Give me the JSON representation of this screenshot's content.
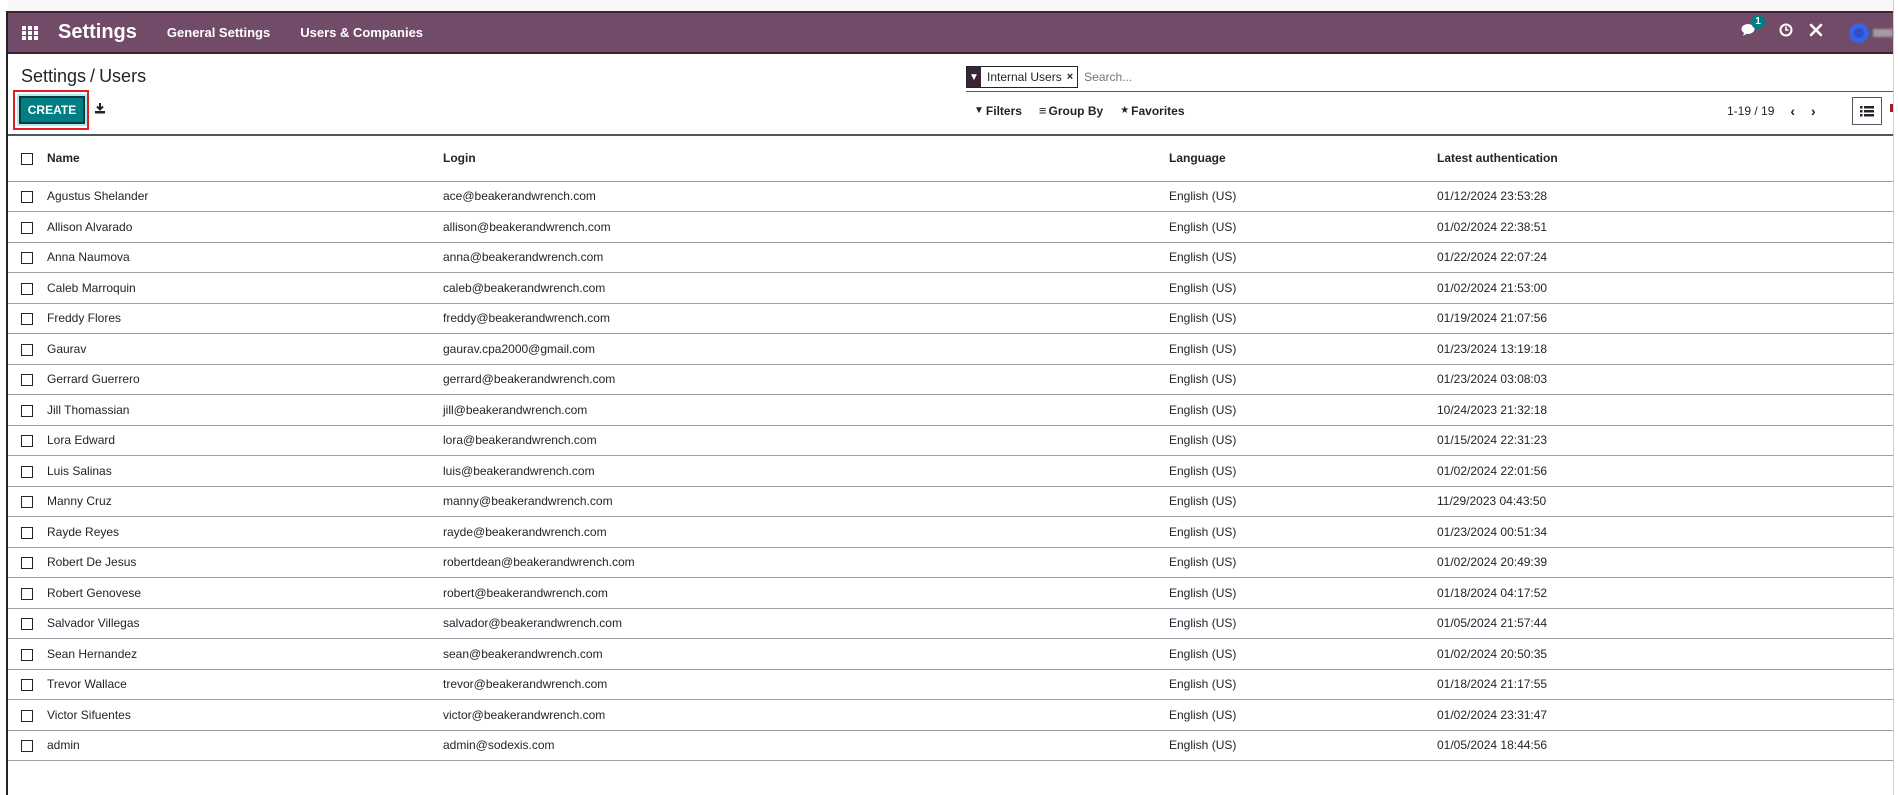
{
  "navbar": {
    "app_title": "Settings",
    "menus": [
      "General Settings",
      "Users & Companies"
    ],
    "chat_badge_count": "1",
    "icons": {
      "apps": "grid-icon",
      "chat": "comments-icon",
      "activity": "clock-icon",
      "debug": "tools-icon"
    }
  },
  "breadcrumb": {
    "parent": "Settings",
    "separator": "/",
    "current": "Users"
  },
  "search": {
    "facet_label": "Internal Users",
    "facet_remove": "×",
    "placeholder": "Search..."
  },
  "toolbar": {
    "create_label": "CREATE",
    "filters_label": "Filters",
    "group_by_label": "Group By",
    "favorites_label": "Favorites"
  },
  "pager": {
    "range": "1-19",
    "separator": "/",
    "total": "19",
    "value": "1-19 / 19"
  },
  "table": {
    "columns": [
      "Name",
      "Login",
      "Language",
      "Latest authentication"
    ],
    "rows": [
      {
        "name": "Agustus Shelander",
        "login": "ace@beakerandwrench.com",
        "language": "English (US)",
        "latest_auth": "01/12/2024 23:53:28"
      },
      {
        "name": "Allison Alvarado",
        "login": "allison@beakerandwrench.com",
        "language": "English (US)",
        "latest_auth": "01/02/2024 22:38:51"
      },
      {
        "name": "Anna Naumova",
        "login": "anna@beakerandwrench.com",
        "language": "English (US)",
        "latest_auth": "01/22/2024 22:07:24"
      },
      {
        "name": "Caleb Marroquin",
        "login": "caleb@beakerandwrench.com",
        "language": "English (US)",
        "latest_auth": "01/02/2024 21:53:00"
      },
      {
        "name": "Freddy Flores",
        "login": "freddy@beakerandwrench.com",
        "language": "English (US)",
        "latest_auth": "01/19/2024 21:07:56"
      },
      {
        "name": "Gaurav",
        "login": "gaurav.cpa2000@gmail.com",
        "language": "English (US)",
        "latest_auth": "01/23/2024 13:19:18"
      },
      {
        "name": "Gerrard Guerrero",
        "login": "gerrard@beakerandwrench.com",
        "language": "English (US)",
        "latest_auth": "01/23/2024 03:08:03"
      },
      {
        "name": "Jill Thomassian",
        "login": "jill@beakerandwrench.com",
        "language": "English (US)",
        "latest_auth": "10/24/2023 21:32:18"
      },
      {
        "name": "Lora Edward",
        "login": "lora@beakerandwrench.com",
        "language": "English (US)",
        "latest_auth": "01/15/2024 22:31:23"
      },
      {
        "name": "Luis Salinas",
        "login": "luis@beakerandwrench.com",
        "language": "English (US)",
        "latest_auth": "01/02/2024 22:01:56"
      },
      {
        "name": "Manny Cruz",
        "login": "manny@beakerandwrench.com",
        "language": "English (US)",
        "latest_auth": "11/29/2023 04:43:50"
      },
      {
        "name": "Rayde Reyes",
        "login": "rayde@beakerandwrench.com",
        "language": "English (US)",
        "latest_auth": "01/23/2024 00:51:34"
      },
      {
        "name": "Robert De Jesus",
        "login": "robertdean@beakerandwrench.com",
        "language": "English (US)",
        "latest_auth": "01/02/2024 20:49:39"
      },
      {
        "name": "Robert Genovese",
        "login": "robert@beakerandwrench.com",
        "language": "English (US)",
        "latest_auth": "01/18/2024 04:17:52"
      },
      {
        "name": "Salvador Villegas",
        "login": "salvador@beakerandwrench.com",
        "language": "English (US)",
        "latest_auth": "01/05/2024 21:57:44"
      },
      {
        "name": "Sean Hernandez",
        "login": "sean@beakerandwrench.com",
        "language": "English (US)",
        "latest_auth": "01/02/2024 20:50:35"
      },
      {
        "name": "Trevor Wallace",
        "login": "trevor@beakerandwrench.com",
        "language": "English (US)",
        "latest_auth": "01/18/2024 21:17:55"
      },
      {
        "name": "Victor Sifuentes",
        "login": "victor@beakerandwrench.com",
        "language": "English (US)",
        "latest_auth": "01/02/2024 23:31:47"
      },
      {
        "name": "admin",
        "login": "admin@sodexis.com",
        "language": "English (US)",
        "latest_auth": "01/05/2024 18:44:56"
      }
    ]
  },
  "colors": {
    "navbar": "#714B67",
    "primary_button": "#017e84",
    "highlight_box": "#e02020"
  }
}
